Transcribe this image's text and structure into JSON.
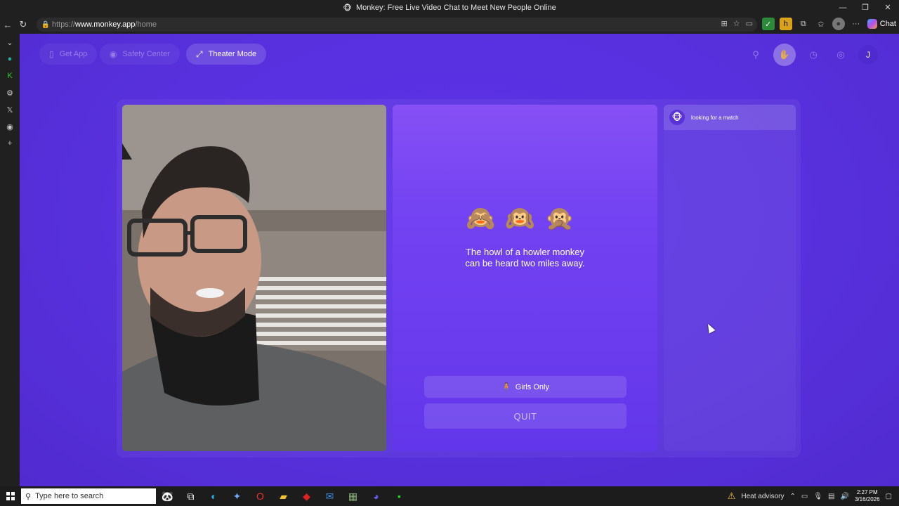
{
  "browser": {
    "title": "Monkey: Free Live Video Chat to Meet New People Online",
    "url_scheme": "https://",
    "url_host": "www.monkey.app",
    "url_path": "/home",
    "chat_label": "Chat"
  },
  "nav": {
    "get_app": "Get App",
    "safety_center": "Safety Center",
    "theater_mode": "Theater Mode",
    "avatar_initial": "J"
  },
  "center": {
    "emojis": "🙈🙉🙊",
    "fact_line1": "The howl of a howler monkey",
    "fact_line2": "can be heard two miles away.",
    "girls_only": "Girls Only",
    "quit": "QUIT"
  },
  "chat": {
    "status": "looking for a match"
  },
  "taskbar": {
    "search_placeholder": "Type here to search",
    "weather": "Heat advisory",
    "time": "2:27 PM",
    "date": "3/16/2026"
  },
  "colors": {
    "page_bg": "#5b2fe0",
    "center_card": "#7443f2",
    "chrome": "#202020"
  }
}
